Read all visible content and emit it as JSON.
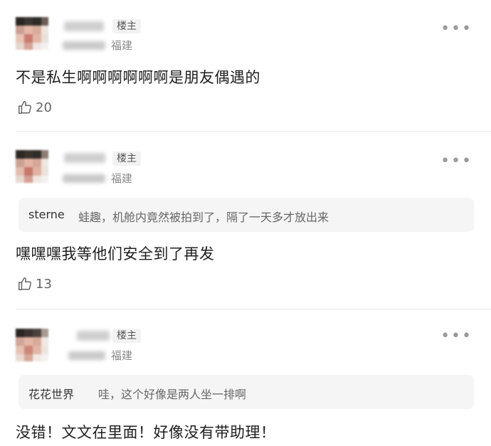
{
  "comments": [
    {
      "badge": "楼主",
      "location": "福建",
      "text": "不是私生啊啊啊啊啊啊是朋友偶遇的",
      "likes": "20",
      "more_icon": "more-dots-icon",
      "like_icon": "thumbs-up-icon"
    },
    {
      "badge": "楼主",
      "location": "福建",
      "quote": {
        "user": "sterne",
        "text": "蛙趣，机舱内竟然被拍到了，隔了一天多才放出来"
      },
      "text": "嘿嘿嘿我等他们安全到了再发",
      "likes": "13",
      "more_icon": "more-dots-icon",
      "like_icon": "thumbs-up-icon"
    },
    {
      "badge": "楼主",
      "location": "福建",
      "quote": {
        "user": "花花世界",
        "text": "哇，这个好像是两人坐一排啊"
      },
      "text": "没错！文文在里面！好像没有带助理！",
      "more_icon": "more-dots-icon"
    }
  ]
}
